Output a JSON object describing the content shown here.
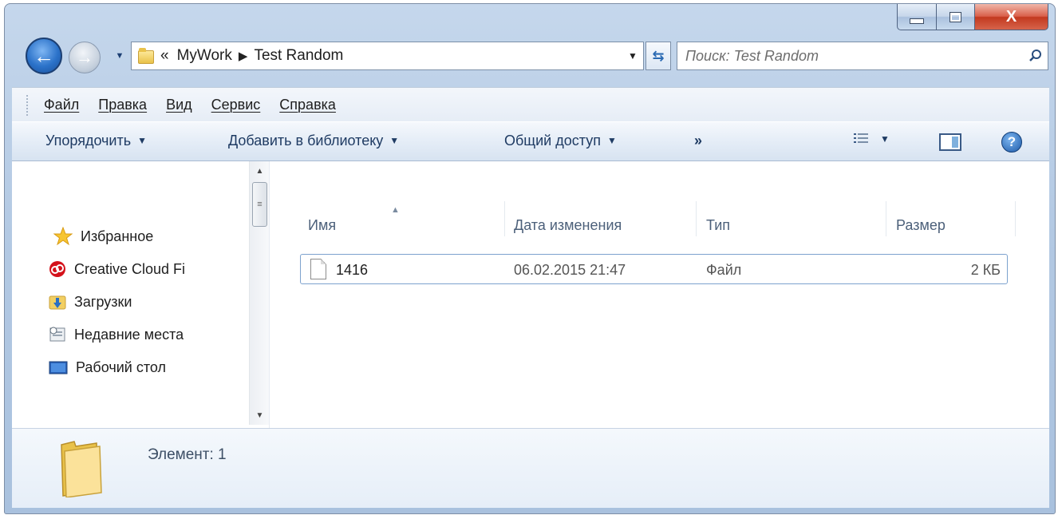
{
  "window": {
    "close_glyph": "X"
  },
  "navigation": {
    "breadcrumb_overflow": "«",
    "breadcrumbs": [
      "MyWork",
      "Test Random"
    ],
    "search_placeholder": "Поиск: Test Random"
  },
  "menubar": {
    "items": [
      "Файл",
      "Правка",
      "Вид",
      "Сервис",
      "Справка"
    ]
  },
  "commandbar": {
    "organize": "Упорядочить",
    "add_to_library": "Добавить в библиотеку",
    "share": "Общий доступ",
    "more": "»"
  },
  "navpane": {
    "favorites": "Избранное",
    "items": [
      "Creative Cloud Fi",
      "Загрузки",
      "Недавние места",
      "Рабочий стол"
    ]
  },
  "filelist": {
    "columns": [
      "Имя",
      "Дата изменения",
      "Тип",
      "Размер"
    ],
    "rows": [
      {
        "name": "1416",
        "date": "06.02.2015 21:47",
        "type": "Файл",
        "size": "2 КБ"
      }
    ]
  },
  "details": {
    "count_label": "Элемент: 1"
  },
  "colors": {
    "accent": "#2b72c9",
    "selection_border": "#7da2ce",
    "header_text": "#4c607a",
    "command_text": "#1f3b63"
  }
}
